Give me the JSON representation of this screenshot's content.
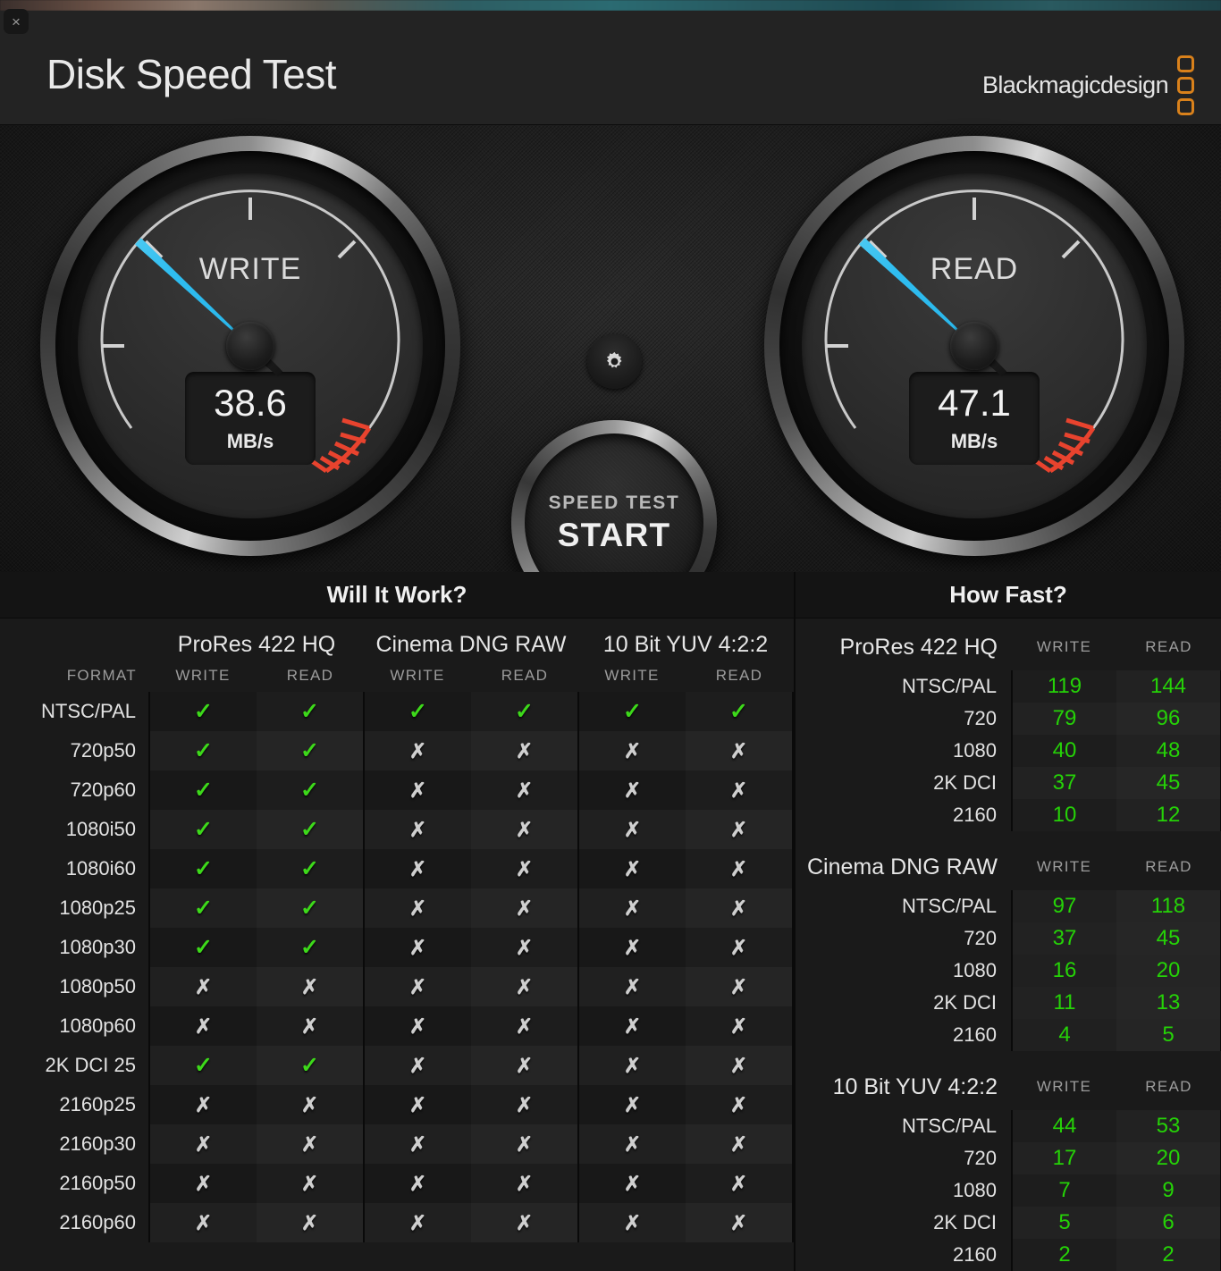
{
  "window": {
    "close_label": "×"
  },
  "header": {
    "title": "Disk Speed Test",
    "brand": "Blackmagicdesign"
  },
  "gauges": {
    "write": {
      "label": "WRITE",
      "value": "38.6",
      "unit": "MB/s",
      "needle_deg": 223
    },
    "read": {
      "label": "READ",
      "value": "47.1",
      "unit": "MB/s",
      "needle_deg": 223
    }
  },
  "controls": {
    "gear_icon": "gear-icon",
    "start_top": "SPEED TEST",
    "start_main": "START"
  },
  "will_it_work": {
    "title": "Will It Work?",
    "format_label": "FORMAT",
    "groups": [
      "ProRes 422 HQ",
      "Cinema DNG RAW",
      "10 Bit YUV 4:2:2"
    ],
    "subcols": [
      "WRITE",
      "READ"
    ],
    "ok_glyph": "✓",
    "no_glyph": "✗",
    "rows": [
      {
        "format": "NTSC/PAL",
        "cells": [
          true,
          true,
          true,
          true,
          true,
          true
        ]
      },
      {
        "format": "720p50",
        "cells": [
          true,
          true,
          false,
          false,
          false,
          false
        ]
      },
      {
        "format": "720p60",
        "cells": [
          true,
          true,
          false,
          false,
          false,
          false
        ]
      },
      {
        "format": "1080i50",
        "cells": [
          true,
          true,
          false,
          false,
          false,
          false
        ]
      },
      {
        "format": "1080i60",
        "cells": [
          true,
          true,
          false,
          false,
          false,
          false
        ]
      },
      {
        "format": "1080p25",
        "cells": [
          true,
          true,
          false,
          false,
          false,
          false
        ]
      },
      {
        "format": "1080p30",
        "cells": [
          true,
          true,
          false,
          false,
          false,
          false
        ]
      },
      {
        "format": "1080p50",
        "cells": [
          false,
          false,
          false,
          false,
          false,
          false
        ]
      },
      {
        "format": "1080p60",
        "cells": [
          false,
          false,
          false,
          false,
          false,
          false
        ]
      },
      {
        "format": "2K DCI 25",
        "cells": [
          true,
          true,
          false,
          false,
          false,
          false
        ]
      },
      {
        "format": "2160p25",
        "cells": [
          false,
          false,
          false,
          false,
          false,
          false
        ]
      },
      {
        "format": "2160p30",
        "cells": [
          false,
          false,
          false,
          false,
          false,
          false
        ]
      },
      {
        "format": "2160p50",
        "cells": [
          false,
          false,
          false,
          false,
          false,
          false
        ]
      },
      {
        "format": "2160p60",
        "cells": [
          false,
          false,
          false,
          false,
          false,
          false
        ]
      }
    ]
  },
  "how_fast": {
    "title": "How Fast?",
    "subcols": [
      "WRITE",
      "READ"
    ],
    "sections": [
      {
        "name": "ProRes 422 HQ",
        "rows": [
          {
            "format": "NTSC/PAL",
            "write": "119",
            "read": "144"
          },
          {
            "format": "720",
            "write": "79",
            "read": "96"
          },
          {
            "format": "1080",
            "write": "40",
            "read": "48"
          },
          {
            "format": "2K DCI",
            "write": "37",
            "read": "45"
          },
          {
            "format": "2160",
            "write": "10",
            "read": "12"
          }
        ]
      },
      {
        "name": "Cinema DNG RAW",
        "rows": [
          {
            "format": "NTSC/PAL",
            "write": "97",
            "read": "118"
          },
          {
            "format": "720",
            "write": "37",
            "read": "45"
          },
          {
            "format": "1080",
            "write": "16",
            "read": "20"
          },
          {
            "format": "2K DCI",
            "write": "11",
            "read": "13"
          },
          {
            "format": "2160",
            "write": "4",
            "read": "5"
          }
        ]
      },
      {
        "name": "10 Bit YUV 4:2:2",
        "rows": [
          {
            "format": "NTSC/PAL",
            "write": "44",
            "read": "53"
          },
          {
            "format": "720",
            "write": "17",
            "read": "20"
          },
          {
            "format": "1080",
            "write": "7",
            "read": "9"
          },
          {
            "format": "2K DCI",
            "write": "5",
            "read": "6"
          },
          {
            "format": "2160",
            "write": "2",
            "read": "2"
          }
        ]
      }
    ]
  },
  "colors": {
    "accent_cyan": "#29b6ea",
    "ok_green": "#3dd91a",
    "value_green": "#25d207",
    "brand_orange": "#d9811b",
    "redzone": "#e8432e"
  }
}
